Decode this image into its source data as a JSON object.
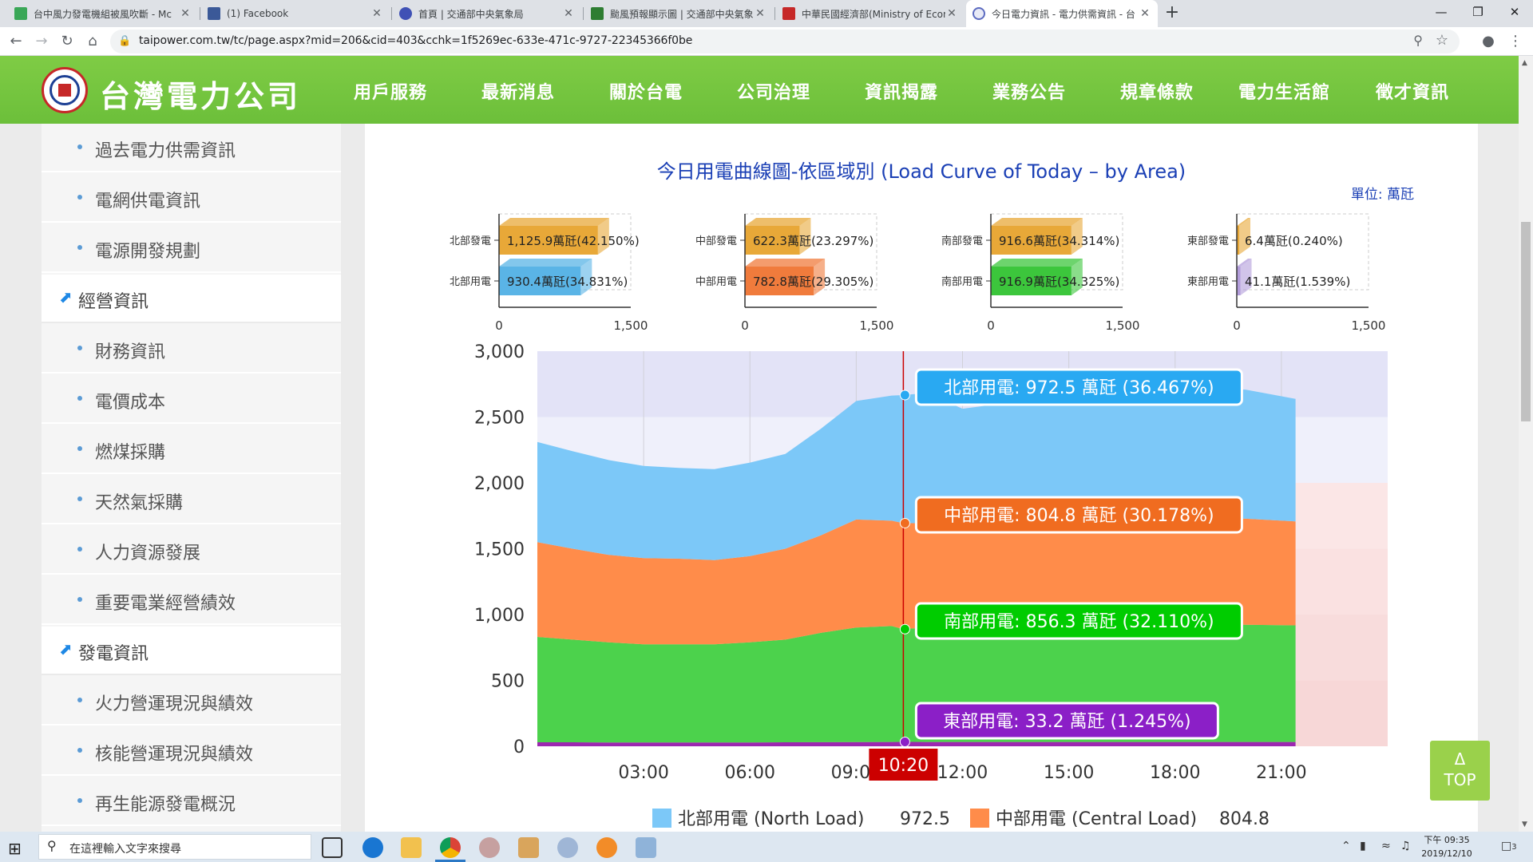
{
  "browser": {
    "tabs": [
      {
        "title": "台中風力發電機組被風吹斷 - Mc",
        "favicon_color": "#3aa757"
      },
      {
        "title": "(1) Facebook",
        "favicon_color": "#3b5998"
      },
      {
        "title": "首頁 | 交通部中央氣象局",
        "favicon_color": "#3f51b5"
      },
      {
        "title": "颱風預報顯示圖 | 交通部中央氣象",
        "favicon_color": "#2e7d32"
      },
      {
        "title": "中華民國經濟部(Ministry of Econ",
        "favicon_color": "#c62828"
      },
      {
        "title": "今日電力資訊 - 電力供需資訊 - 台",
        "favicon_color": "#5c6bc0"
      }
    ],
    "new_tab": "+",
    "close_glyph": "✕",
    "url": "taipower.com.tw/tc/page.aspx?mid=206&cid=403&cchk=1f5269ec-633e-471c-9727-22345366f0be"
  },
  "site": {
    "logo_text": "台灣電力公司",
    "nav": [
      "用戶服務",
      "最新消息",
      "關於台電",
      "公司治理",
      "資訊揭露",
      "業務公告",
      "規章條款",
      "電力生活館",
      "徵才資訊"
    ],
    "active_nav": "資訊揭露"
  },
  "sidebar": {
    "items": [
      {
        "label": "過去電力供需資訊",
        "section": false
      },
      {
        "label": "電網供電資訊",
        "section": false
      },
      {
        "label": "電源開發規劃",
        "section": false
      },
      {
        "label": "經營資訊",
        "section": true
      },
      {
        "label": "財務資訊",
        "section": false
      },
      {
        "label": "電價成本",
        "section": false
      },
      {
        "label": "燃煤採購",
        "section": false
      },
      {
        "label": "天然氣採購",
        "section": false
      },
      {
        "label": "人力資源發展",
        "section": false
      },
      {
        "label": "重要電業經營績效",
        "section": false
      },
      {
        "label": "發電資訊",
        "section": true
      },
      {
        "label": "火力營運現況與績效",
        "section": false
      },
      {
        "label": "核能營運現況與績效",
        "section": false
      },
      {
        "label": "再生能源發電概況",
        "section": false
      }
    ]
  },
  "main": {
    "title": "今日用電曲線圖-依區域別 (Load Curve of Today – by Area)",
    "unit": "單位: 萬瓩",
    "top_button": {
      "arrow": "Δ",
      "label": "TOP"
    }
  },
  "chart_data": [
    {
      "type": "bar",
      "orientation": "horizontal",
      "region": "北部",
      "categories": [
        "北部發電",
        "北部用電"
      ],
      "values": [
        1125.9,
        930.4
      ],
      "labels": [
        "1,125.9萬瓩(42.150%)",
        "930.4萬瓩(34.831%)"
      ],
      "colors": [
        "#e8a838",
        "#5ab4e6"
      ],
      "xlim": [
        0,
        1500
      ],
      "ticks": [
        "0",
        "1,500"
      ]
    },
    {
      "type": "bar",
      "orientation": "horizontal",
      "region": "中部",
      "categories": [
        "中部發電",
        "中部用電"
      ],
      "values": [
        622.3,
        782.8
      ],
      "labels": [
        "622.3萬瓩(23.297%)",
        "782.8萬瓩(29.305%)"
      ],
      "colors": [
        "#e8a838",
        "#f07b3c"
      ],
      "xlim": [
        0,
        1500
      ],
      "ticks": [
        "0",
        "1,500"
      ]
    },
    {
      "type": "bar",
      "orientation": "horizontal",
      "region": "南部",
      "categories": [
        "南部發電",
        "南部用電"
      ],
      "values": [
        916.6,
        916.9
      ],
      "labels": [
        "916.6萬瓩(34.314%)",
        "916.9萬瓩(34.325%)"
      ],
      "colors": [
        "#e8a838",
        "#3cc63c"
      ],
      "xlim": [
        0,
        1500
      ],
      "ticks": [
        "0",
        "1,500"
      ]
    },
    {
      "type": "bar",
      "orientation": "horizontal",
      "region": "東部",
      "categories": [
        "東部發電",
        "東部用電"
      ],
      "values": [
        6.4,
        41.1
      ],
      "labels": [
        "6.4萬瓩(0.240%)",
        "41.1萬瓩(1.539%)"
      ],
      "colors": [
        "#e8a838",
        "#b39ddb"
      ],
      "xlim": [
        0,
        1500
      ],
      "ticks": [
        "0",
        "1,500"
      ]
    },
    {
      "type": "area",
      "stacked": true,
      "ylim": [
        0,
        3000
      ],
      "y_ticks": [
        "0",
        "500",
        "1,000",
        "1,500",
        "2,000",
        "2,500",
        "3,000"
      ],
      "x_ticks": [
        "03:00",
        "06:00",
        "09:00",
        "12:00",
        "15:00",
        "18:00",
        "21:00"
      ],
      "xlim": [
        0,
        24
      ],
      "x": [
        0,
        1,
        2,
        3,
        4,
        5,
        6,
        7,
        8,
        9,
        10,
        10.33,
        11,
        12,
        13,
        14,
        15,
        16,
        17,
        18,
        19,
        20,
        21.4
      ],
      "series": [
        {
          "name": "東部用電",
          "color": "#9c27b0",
          "values": [
            30,
            30,
            29,
            29,
            29,
            29,
            29,
            30,
            31,
            32,
            33,
            33.2,
            33,
            33,
            33,
            33,
            33,
            33,
            33,
            33,
            33,
            33,
            33
          ]
        },
        {
          "name": "南部用電",
          "color": "#4cd24c",
          "values": [
            800,
            780,
            760,
            745,
            745,
            745,
            760,
            780,
            830,
            870,
            880,
            856.3,
            870,
            880,
            895,
            895,
            895,
            890,
            890,
            895,
            895,
            890,
            885
          ]
        },
        {
          "name": "中部用電",
          "color": "#ff8c4a",
          "values": [
            720,
            690,
            665,
            655,
            650,
            640,
            655,
            690,
            740,
            820,
            800,
            804.8,
            790,
            790,
            770,
            775,
            785,
            790,
            800,
            805,
            810,
            805,
            790
          ]
        },
        {
          "name": "北部用電",
          "color": "#7cc8f8",
          "values": [
            760,
            740,
            720,
            700,
            690,
            690,
            710,
            720,
            810,
            900,
            950,
            972.5,
            990,
            860,
            900,
            920,
            920,
            930,
            960,
            990,
            990,
            980,
            930
          ]
        }
      ],
      "cursor": {
        "label": "10:20",
        "x": 10.33
      },
      "tooltips": [
        "北部用電: 972.5 萬瓩 (36.467%)",
        "中部用電: 804.8 萬瓩 (30.178%)",
        "南部用電: 856.3 萬瓩 (32.110%)",
        "東部用電: 33.2 萬瓩 (1.245%)"
      ],
      "tooltip_colors": [
        "#29a9f2",
        "#f06c20",
        "#00cc00",
        "#8b1fc7"
      ],
      "legend": [
        {
          "label": "北部用電 (North Load)",
          "value": "972.5",
          "color": "#7cc8f8"
        },
        {
          "label": "中部用電 (Central Load)",
          "value": "804.8",
          "color": "#ff8c4a"
        }
      ]
    }
  ],
  "taskbar": {
    "search_placeholder": "在這裡輸入文字來搜尋",
    "time": "下午 09:35",
    "date": "2019/12/10",
    "notif_count": "3"
  }
}
